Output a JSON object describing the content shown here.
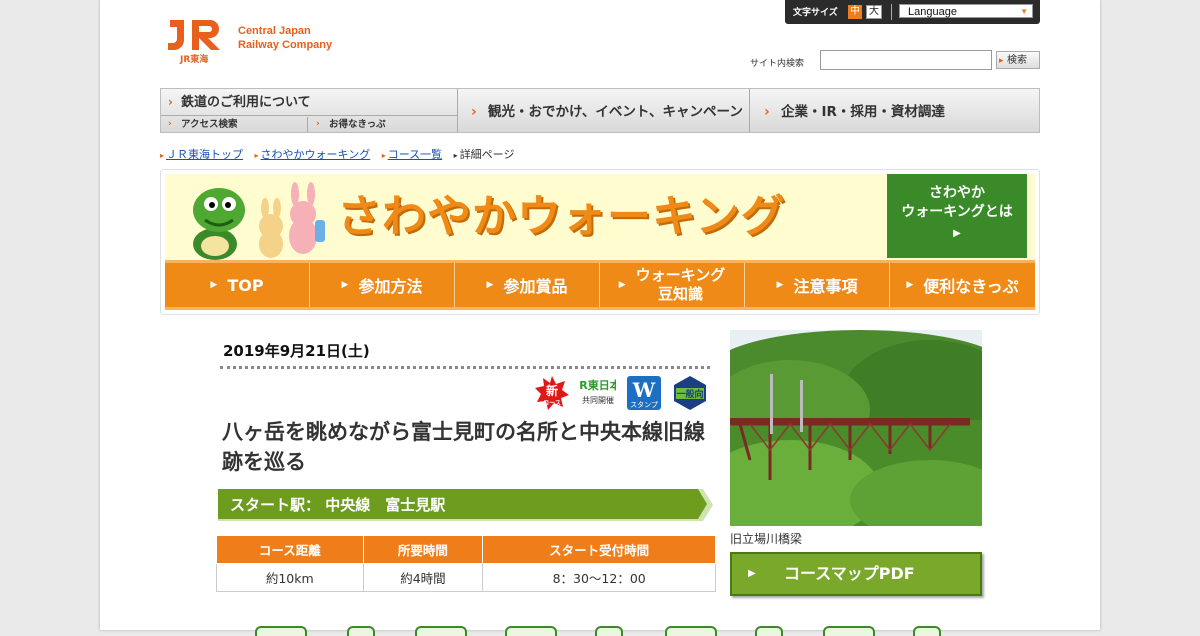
{
  "header": {
    "logo_line1": "Central Japan",
    "logo_line2": "Railway Company",
    "logo_sub": "JR東海",
    "font_size_label": "文字サイズ",
    "font_mid": "中",
    "font_big": "大",
    "language": "Language",
    "search_label": "サイト内検索",
    "search_value": "",
    "search_button": "検索"
  },
  "gnav": {
    "rail": "鉄道のご利用について",
    "access": "アクセス検索",
    "tickets": "お得なきっぷ",
    "tourism": "観光・おでかけ、イベント、キャンペーン",
    "corporate": "企業・IR・採用・資材調達"
  },
  "breadcrumb": {
    "items": [
      "ＪＲ東海トップ",
      "さわやかウォーキング",
      "コース一覧"
    ],
    "current": "詳細ページ"
  },
  "banner": {
    "title": "さわやかウォーキング",
    "about_line1": "さわやか",
    "about_line2": "ウォーキングとは",
    "tabs": [
      "TOP",
      "参加方法",
      "参加賞品",
      "ウォーキング",
      "豆知識",
      "注意事項",
      "便利なきっぷ"
    ]
  },
  "event": {
    "date": "2019年9月21日(土)",
    "badges": [
      "新コース",
      "JR東日本共同開催",
      "Wスタンプ",
      "一般向"
    ],
    "title": "八ヶ岳を眺めながら富士見町の名所と中央本線旧線跡を巡る",
    "start_station": "スタート駅： 中央線　富士見駅",
    "table_headers": [
      "コース距離",
      "所要時間",
      "スタート受付時間"
    ],
    "table_values": [
      "約10km",
      "約4時間",
      "8：30～12：00"
    ],
    "photo_caption": "旧立場川橋梁",
    "pdf_button": "コースマップPDF"
  },
  "colors": {
    "accent_orange": "#ef7d1a",
    "brand_green": "#3b8a2a",
    "banner_yellow": "#fffcd0"
  }
}
